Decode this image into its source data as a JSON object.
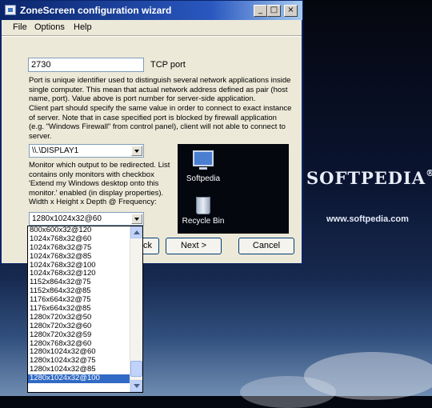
{
  "window": {
    "title": "ZoneScreen configuration wizard",
    "controls": {
      "minimize": "_",
      "maximize": "□",
      "close": "×"
    }
  },
  "menu": {
    "file": "File",
    "options": "Options",
    "help": "Help"
  },
  "port": {
    "value": "2730",
    "label": "TCP port",
    "description_1": "Port is unique identifier used to distinguish several network applications inside single computer. This mean that actual network address defined as pair (host name, port). Value above is port number for server-side application.",
    "description_2": "Client part should specify the same value in order to connect to exact instance of server. Note that in case specified port is blocked by firewall application (e.g. \"Windows Firewall\" from control panel), client will not able to connect to server."
  },
  "monitor": {
    "selected": "\\\\.\\DISPLAY1",
    "description": "Monitor which output to be redirected. List contains only monitors with checkbox 'Extend my Windows desktop onto this monitor.' enabled (in display properties). Width x Height x Depth @ Frequency:"
  },
  "mode": {
    "selected": "1280x1024x32@60",
    "options": [
      "800x600x32@120",
      "1024x768x32@60",
      "1024x768x32@75",
      "1024x768x32@85",
      "1024x768x32@100",
      "1024x768x32@120",
      "1152x864x32@75",
      "1152x864x32@85",
      "1176x664x32@75",
      "1176x664x32@85",
      "1280x720x32@50",
      "1280x720x32@60",
      "1280x720x32@59",
      "1280x768x32@60",
      "1280x1024x32@60",
      "1280x1024x32@75",
      "1280x1024x32@85",
      "1280x1024x32@100"
    ],
    "highlighted_index": 17
  },
  "preview": {
    "icon1_label": "Softpedia",
    "icon2_label": "Recycle Bin"
  },
  "buttons": {
    "back_partial": "ck",
    "next": "Next >",
    "cancel": "Cancel"
  },
  "desktop": {
    "logo": "SOFTPEDIA",
    "logo_mark": "®",
    "url": "www.softpedia.com"
  },
  "colors": {
    "titlebar": "#0a246a",
    "selection": "#316ac5",
    "window_bg": "#ece9d8"
  }
}
